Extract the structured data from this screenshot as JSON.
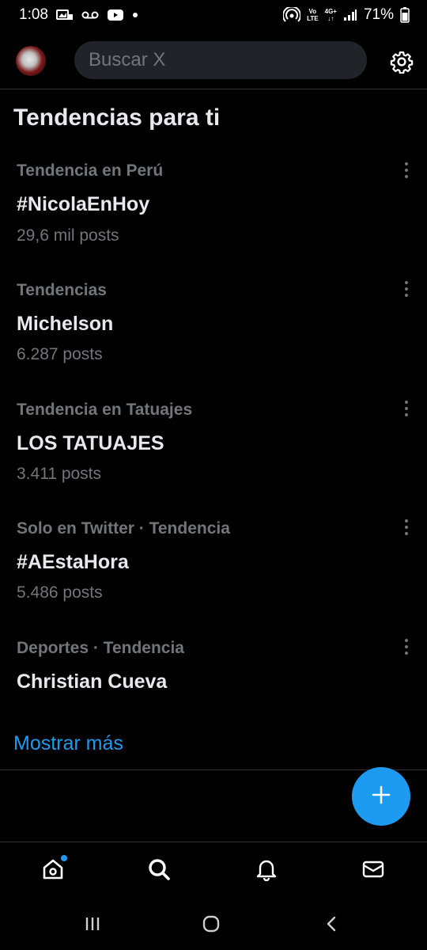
{
  "status_bar": {
    "time": "1:08",
    "battery": "71%",
    "network_label_top": "Vo",
    "network_label_bottom": "LTE",
    "network_type": "4G+"
  },
  "header": {
    "search_placeholder": "Buscar X"
  },
  "section_title": "Tendencias para ti",
  "trends": [
    {
      "context": "Tendencia en Perú",
      "name": "#NicolaEnHoy",
      "count": "29,6 mil posts"
    },
    {
      "context": "Tendencias",
      "name": "Michelson",
      "count": "6.287 posts"
    },
    {
      "context": "Tendencia en Tatuajes",
      "name": "LOS TATUAJES",
      "count": "3.411 posts"
    },
    {
      "context": "Solo en Twitter · Tendencia",
      "name": "#AEstaHora",
      "count": "5.486 posts"
    },
    {
      "context": "Deportes · Tendencia",
      "name": "Christian Cueva",
      "count": ""
    }
  ],
  "show_more": "Mostrar más",
  "icons": {
    "settings": "gear-icon",
    "more": "more-vertical-icon",
    "compose": "plus-icon",
    "home": "home-icon",
    "search": "search-icon",
    "notifications": "bell-icon",
    "messages": "mail-icon"
  },
  "colors": {
    "background": "#000000",
    "accent": "#1d9bf0",
    "primary_text": "#e7e9ea",
    "secondary_text": "#71767b",
    "search_bg": "#202327"
  }
}
